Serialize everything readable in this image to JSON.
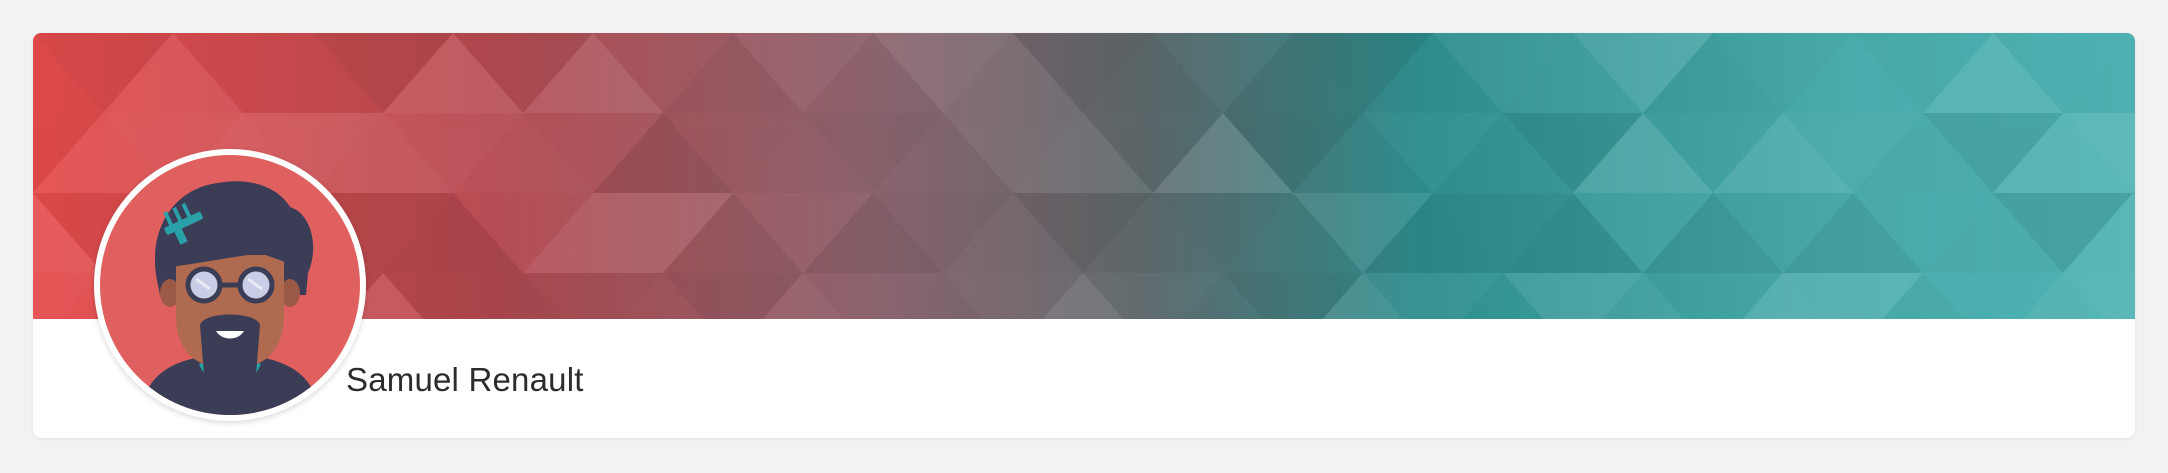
{
  "profile": {
    "name": "Samuel Renault",
    "avatar_icon": "avatar-icon",
    "banner_colors": [
      "#e64c4c",
      "#9a5a60",
      "#5f6b6e",
      "#2f8f8f",
      "#5fbcbc"
    ]
  }
}
